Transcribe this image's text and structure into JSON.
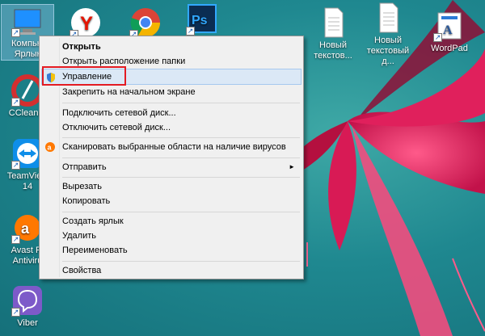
{
  "desktop": {
    "icons": [
      {
        "label": "Компью\nЯрлык",
        "icon": "computer-icon"
      },
      {
        "label": "",
        "icon": "yandex-browser-icon"
      },
      {
        "label": "",
        "icon": "chrome-icon"
      },
      {
        "label": "",
        "icon": "photoshop-icon"
      },
      {
        "label": "Новый\nтекстов...",
        "icon": "text-document-icon"
      },
      {
        "label": "Новый\nтекстовый д...",
        "icon": "text-document-icon"
      },
      {
        "label": "WordPad",
        "icon": "wordpad-icon"
      },
      {
        "label": "CCleaner",
        "icon": "ccleaner-icon"
      },
      {
        "label": "TeamView\n14",
        "icon": "teamviewer-icon"
      },
      {
        "label": "Avast Fr\nAntiviru",
        "icon": "avast-icon"
      },
      {
        "label": "Viber",
        "icon": "viber-icon"
      }
    ]
  },
  "context_menu": {
    "items": [
      {
        "label": "Открыть"
      },
      {
        "label": "Открыть расположение папки"
      },
      {
        "label": "Управление",
        "icon": "shield-icon"
      },
      {
        "label": "Закрепить на начальном экране"
      },
      {
        "label": "Подключить сетевой диск..."
      },
      {
        "label": "Отключить сетевой диск..."
      },
      {
        "label": "Сканировать выбранные области на наличие вирусов",
        "icon": "avast-icon"
      },
      {
        "label": "Отправить",
        "submenu_arrow": "►"
      },
      {
        "label": "Вырезать"
      },
      {
        "label": "Копировать"
      },
      {
        "label": "Создать ярлык"
      },
      {
        "label": "Удалить"
      },
      {
        "label": "Переименовать"
      },
      {
        "label": "Свойства"
      }
    ],
    "hover_item": "Управление",
    "highlight_color": "#e31b23"
  }
}
